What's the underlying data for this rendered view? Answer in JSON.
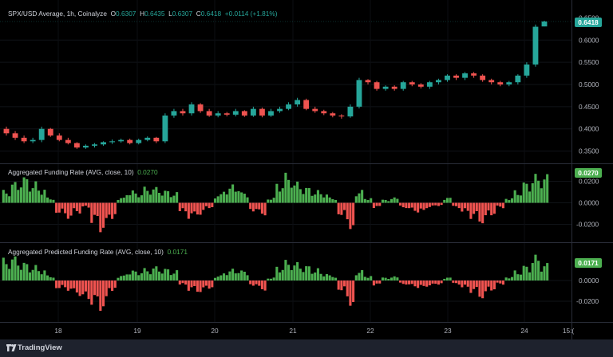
{
  "price_pane": {
    "symbol": "SPX/USD Average",
    "interval": "1h",
    "exchange": "Coinalyze",
    "o_label": "O",
    "o_value": "0.6307",
    "h_label": "H",
    "h_value": "0.6435",
    "l_label": "L",
    "l_value": "0.6307",
    "c_label": "C",
    "c_value": "0.6418",
    "change": "+0.0114 (+1.81%)",
    "last_price_tag": "0.6418",
    "hidden_tick": "0.6500",
    "ticks": [
      "0.6000",
      "0.5500",
      "0.5000",
      "0.4500",
      "0.4000",
      "0.3500"
    ]
  },
  "funding_pane": {
    "title": "Aggregated Funding Rate (AVG, close, 10)",
    "value": "0.0270",
    "tag": "0.0270",
    "ticks": [
      "0.0200",
      "0.0000",
      "-0.0200"
    ]
  },
  "predicted_pane": {
    "title": "Aggregated Predicted Funding Rate (AVG, close, 10)",
    "value": "0.0171",
    "tag": "0.0171",
    "ticks": [
      "0.0000",
      "-0.0200"
    ]
  },
  "time_axis": [
    "18",
    "19",
    "20",
    "21",
    "22",
    "23",
    "24",
    "15:("
  ],
  "branding": "TradingView",
  "colors": {
    "up": "#26a69a",
    "down": "#ef5350",
    "hist_up": "#4caf50",
    "hist_down": "#ef5350",
    "price_tag": "#26a69a",
    "funding_tag": "#4caf50"
  },
  "chart_data": [
    {
      "type": "candlestick",
      "title": "SPX/USD Average, 1h, Coinalyze",
      "x_ticks": [
        "18",
        "19",
        "20",
        "21",
        "22",
        "23",
        "24"
      ],
      "ylim": [
        0.33,
        0.66
      ],
      "close": [
        0.39,
        0.38,
        0.372,
        0.375,
        0.4,
        0.385,
        0.375,
        0.368,
        0.358,
        0.362,
        0.365,
        0.37,
        0.372,
        0.375,
        0.368,
        0.375,
        0.38,
        0.372,
        0.43,
        0.44,
        0.435,
        0.455,
        0.44,
        0.43,
        0.435,
        0.432,
        0.44,
        0.43,
        0.445,
        0.43,
        0.44,
        0.445,
        0.455,
        0.465,
        0.445,
        0.44,
        0.435,
        0.43,
        0.428,
        0.45,
        0.51,
        0.505,
        0.49,
        0.495,
        0.49,
        0.505,
        0.5,
        0.495,
        0.505,
        0.51,
        0.52,
        0.515,
        0.525,
        0.52,
        0.51,
        0.505,
        0.5,
        0.505,
        0.52,
        0.545,
        0.63,
        0.6418
      ],
      "open": [
        0.4,
        0.39,
        0.38,
        0.372,
        0.375,
        0.4,
        0.385,
        0.375,
        0.368,
        0.358,
        0.362,
        0.365,
        0.37,
        0.372,
        0.375,
        0.368,
        0.375,
        0.38,
        0.372,
        0.43,
        0.44,
        0.435,
        0.455,
        0.44,
        0.43,
        0.435,
        0.432,
        0.44,
        0.43,
        0.445,
        0.43,
        0.44,
        0.445,
        0.455,
        0.465,
        0.445,
        0.44,
        0.435,
        0.43,
        0.428,
        0.45,
        0.51,
        0.505,
        0.49,
        0.495,
        0.49,
        0.505,
        0.5,
        0.495,
        0.505,
        0.51,
        0.52,
        0.515,
        0.525,
        0.52,
        0.51,
        0.505,
        0.5,
        0.505,
        0.52,
        0.545,
        0.6307
      ],
      "high": [
        0.405,
        0.395,
        0.385,
        0.38,
        0.405,
        0.402,
        0.39,
        0.38,
        0.37,
        0.365,
        0.368,
        0.372,
        0.376,
        0.378,
        0.378,
        0.378,
        0.383,
        0.382,
        0.435,
        0.445,
        0.445,
        0.46,
        0.458,
        0.445,
        0.44,
        0.438,
        0.445,
        0.442,
        0.45,
        0.448,
        0.445,
        0.45,
        0.46,
        0.47,
        0.468,
        0.45,
        0.443,
        0.438,
        0.433,
        0.455,
        0.515,
        0.512,
        0.508,
        0.498,
        0.498,
        0.508,
        0.508,
        0.503,
        0.508,
        0.513,
        0.523,
        0.523,
        0.528,
        0.528,
        0.523,
        0.513,
        0.508,
        0.508,
        0.523,
        0.55,
        0.635,
        0.6435
      ],
      "low": [
        0.385,
        0.375,
        0.368,
        0.368,
        0.37,
        0.382,
        0.372,
        0.365,
        0.355,
        0.355,
        0.358,
        0.362,
        0.366,
        0.369,
        0.365,
        0.365,
        0.372,
        0.368,
        0.368,
        0.425,
        0.43,
        0.43,
        0.436,
        0.427,
        0.426,
        0.428,
        0.428,
        0.427,
        0.427,
        0.426,
        0.427,
        0.436,
        0.442,
        0.45,
        0.442,
        0.436,
        0.431,
        0.426,
        0.423,
        0.425,
        0.446,
        0.5,
        0.486,
        0.486,
        0.486,
        0.486,
        0.496,
        0.491,
        0.49,
        0.5,
        0.506,
        0.51,
        0.51,
        0.515,
        0.506,
        0.5,
        0.496,
        0.496,
        0.5,
        0.515,
        0.54,
        0.6307
      ]
    },
    {
      "type": "bar",
      "title": "Aggregated Funding Rate (AVG, close, 10)",
      "ylim": [
        -0.04,
        0.045
      ],
      "values": [
        0.012,
        0.02,
        0.025,
        0.02,
        0.015,
        0.005,
        -0.01,
        -0.015,
        -0.01,
        -0.005,
        -0.02,
        -0.028,
        -0.015,
        0.005,
        0.012,
        0.01,
        0.015,
        0.015,
        0.012,
        0.01,
        -0.01,
        -0.015,
        -0.012,
        -0.005,
        0.008,
        0.015,
        0.018,
        0.01,
        -0.008,
        -0.012,
        0.005,
        0.02,
        0.028,
        0.02,
        0.015,
        0.012,
        0.01,
        0.005,
        -0.012,
        -0.025,
        0.012,
        0.005,
        -0.005,
        0.003,
        0.005,
        -0.005,
        -0.008,
        -0.01,
        -0.005,
        -0.003,
        0.005,
        -0.005,
        -0.01,
        -0.015,
        -0.02,
        -0.012,
        -0.005,
        0.005,
        0.012,
        0.02,
        0.027,
        0.027
      ]
    },
    {
      "type": "bar",
      "title": "Aggregated Predicted Funding Rate (AVG, close, 10)",
      "ylim": [
        -0.04,
        0.045
      ],
      "values": [
        0.022,
        0.024,
        0.018,
        0.015,
        0.012,
        0.005,
        -0.008,
        -0.01,
        -0.015,
        -0.02,
        -0.025,
        -0.03,
        -0.01,
        0.005,
        0.01,
        0.01,
        0.012,
        0.014,
        0.012,
        0.01,
        -0.005,
        -0.01,
        -0.012,
        -0.008,
        0.005,
        0.01,
        0.012,
        0.01,
        -0.005,
        -0.01,
        0.003,
        0.015,
        0.02,
        0.018,
        0.015,
        0.012,
        0.008,
        0.005,
        -0.01,
        -0.025,
        0.01,
        0.005,
        -0.005,
        0.003,
        0.004,
        -0.004,
        -0.006,
        -0.008,
        -0.006,
        -0.004,
        0.003,
        -0.004,
        -0.008,
        -0.012,
        -0.018,
        -0.01,
        -0.004,
        0.004,
        0.01,
        0.015,
        0.025,
        0.0171
      ]
    }
  ]
}
